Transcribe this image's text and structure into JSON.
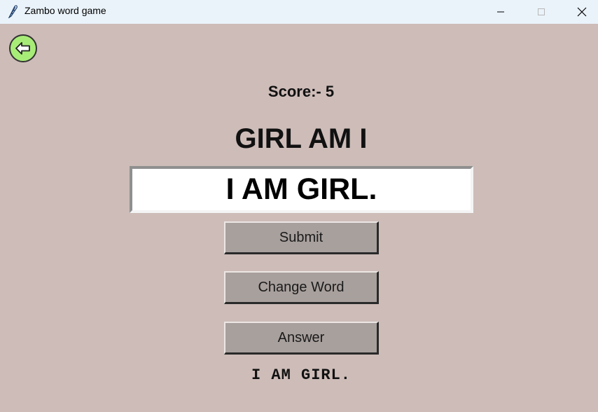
{
  "window": {
    "title": "Zambo word game",
    "controls": [
      "minimize",
      "maximize",
      "close"
    ]
  },
  "icons": {
    "app": "feather-icon",
    "back": "arrow-left-icon",
    "back_color": "#a8ec78"
  },
  "game": {
    "score_text": "Score:- 5",
    "scrambled_word": "GIRL AM I",
    "entry_value": "I AM GIRL.",
    "answer_text": "I AM GIRL."
  },
  "buttons": {
    "submit_label": "Submit",
    "change_word_label": "Change Word",
    "answer_label": "Answer"
  },
  "colors": {
    "background": "#cdbcb8",
    "button_face": "#a8a09d",
    "titlebar": "#eaf3fa"
  }
}
